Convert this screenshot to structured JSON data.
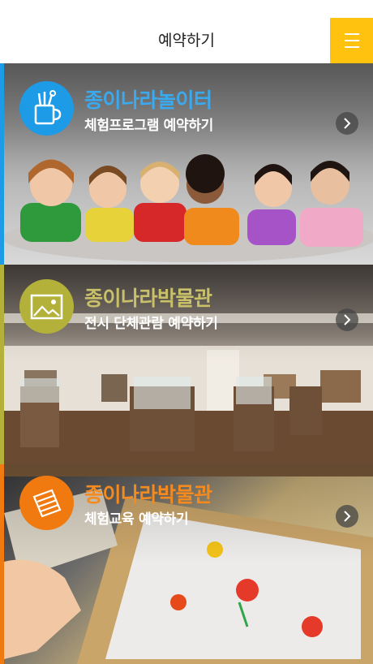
{
  "header": {
    "title": "예약하기",
    "menu_icon": "hamburger-menu-icon"
  },
  "panels": [
    {
      "title": "종이나라놀이터",
      "subtitle": "체험프로그램 예약하기",
      "icon": "craft-tools-cup-icon",
      "accent_color": "#1e9be6",
      "title_color": "#39a9f0"
    },
    {
      "title": "종이나라박물관",
      "subtitle": "전시 단체관람 예약하기",
      "icon": "picture-frame-icon",
      "accent_color": "#b3b13a",
      "title_color": "#c9c16a"
    },
    {
      "title": "종이나라박물관",
      "subtitle": "체험교육 예약하기",
      "icon": "paper-sheets-icon",
      "accent_color": "#f07a10",
      "title_color": "#f58a1f"
    }
  ]
}
